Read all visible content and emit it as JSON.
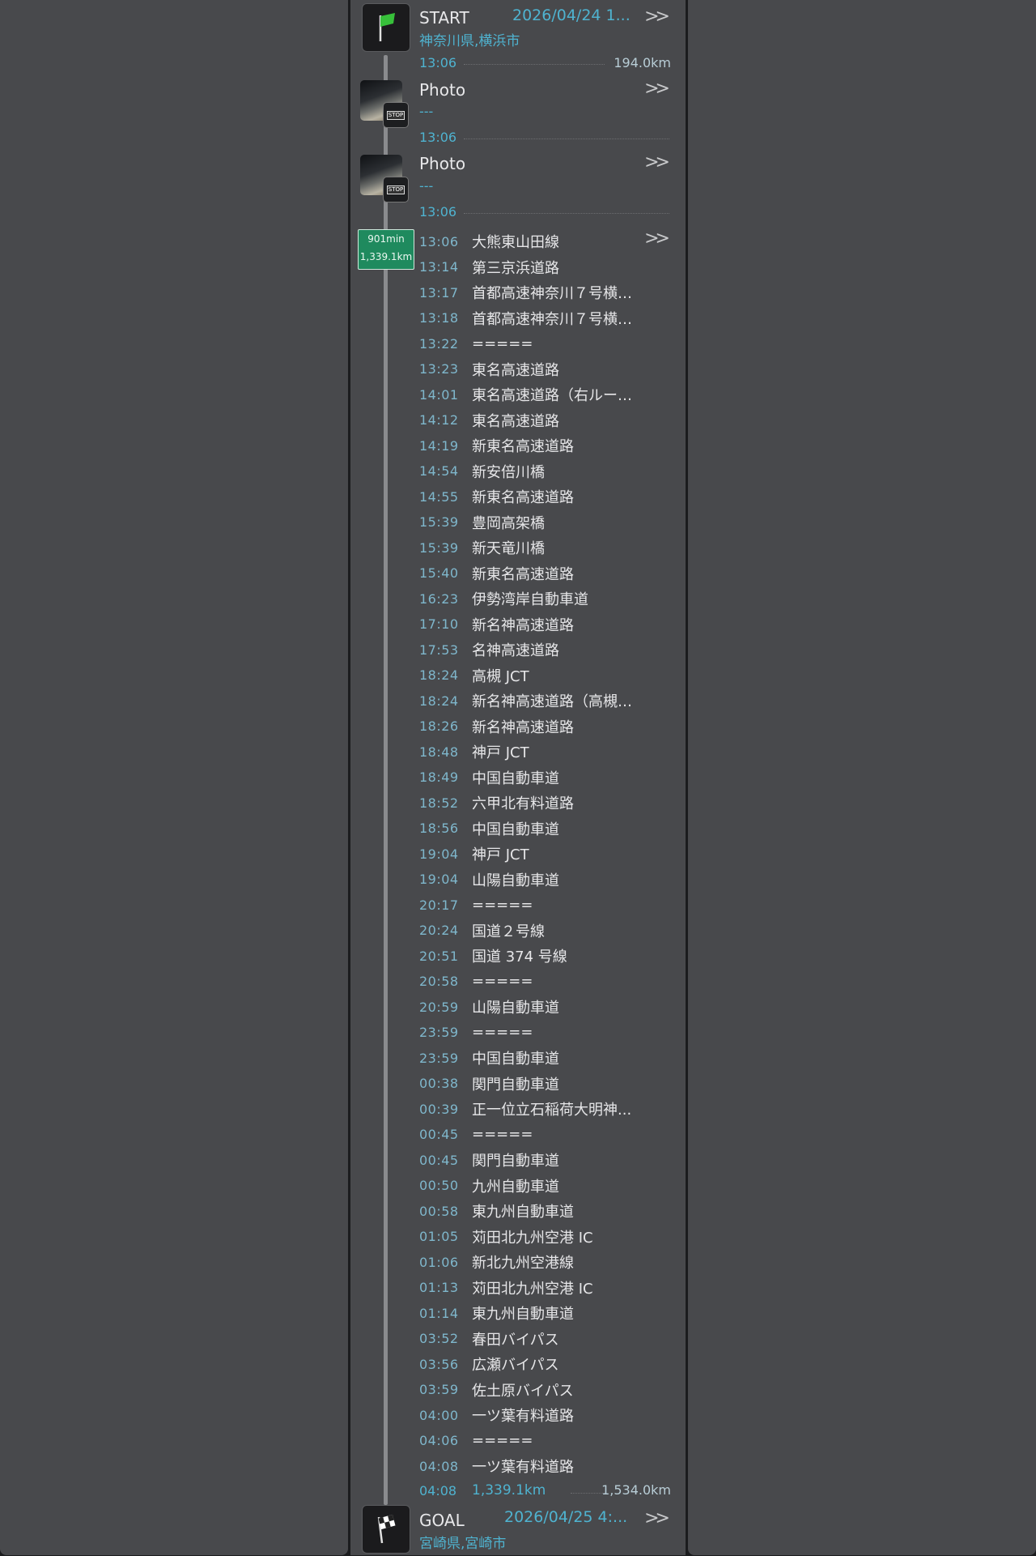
{
  "start": {
    "label": "START",
    "datetime": "2026/04/24 1...",
    "place": "神奈川県,横浜市",
    "time": "13:06",
    "distance": "194.0km"
  },
  "photos": [
    {
      "label": "Photo",
      "sub": "---",
      "time": "13:06",
      "stop": "STOP"
    },
    {
      "label": "Photo",
      "sub": "---",
      "time": "13:06",
      "stop": "STOP"
    }
  ],
  "segment": {
    "duration": "901min",
    "distance": "1,339.1km"
  },
  "route": [
    {
      "time": "13:06",
      "name": "大熊東山田線"
    },
    {
      "time": "13:14",
      "name": "第三京浜道路"
    },
    {
      "time": "13:17",
      "name": "首都高速神奈川７号横…"
    },
    {
      "time": "13:18",
      "name": "首都高速神奈川７号横…"
    },
    {
      "time": "13:22",
      "name": "====="
    },
    {
      "time": "13:23",
      "name": "東名高速道路"
    },
    {
      "time": "14:01",
      "name": "東名高速道路（右ルー…"
    },
    {
      "time": "14:12",
      "name": "東名高速道路"
    },
    {
      "time": "14:19",
      "name": "新東名高速道路"
    },
    {
      "time": "14:54",
      "name": "新安倍川橋"
    },
    {
      "time": "14:55",
      "name": "新東名高速道路"
    },
    {
      "time": "15:39",
      "name": "豊岡高架橋"
    },
    {
      "time": "15:39",
      "name": "新天竜川橋"
    },
    {
      "time": "15:40",
      "name": "新東名高速道路"
    },
    {
      "time": "16:23",
      "name": "伊勢湾岸自動車道"
    },
    {
      "time": "17:10",
      "name": "新名神高速道路"
    },
    {
      "time": "17:53",
      "name": "名神高速道路"
    },
    {
      "time": "18:24",
      "name": "高槻 JCT"
    },
    {
      "time": "18:24",
      "name": "新名神高速道路（高槻…"
    },
    {
      "time": "18:26",
      "name": "新名神高速道路"
    },
    {
      "time": "18:48",
      "name": "神戸 JCT"
    },
    {
      "time": "18:49",
      "name": "中国自動車道"
    },
    {
      "time": "18:52",
      "name": "六甲北有料道路"
    },
    {
      "time": "18:56",
      "name": "中国自動車道"
    },
    {
      "time": "19:04",
      "name": "神戸 JCT"
    },
    {
      "time": "19:04",
      "name": "山陽自動車道"
    },
    {
      "time": "20:17",
      "name": "====="
    },
    {
      "time": "20:24",
      "name": "国道２号線"
    },
    {
      "time": "20:51",
      "name": "国道 374 号線"
    },
    {
      "time": "20:58",
      "name": "====="
    },
    {
      "time": "20:59",
      "name": "山陽自動車道"
    },
    {
      "time": "23:59",
      "name": "====="
    },
    {
      "time": "23:59",
      "name": "中国自動車道"
    },
    {
      "time": "00:38",
      "name": "関門自動車道"
    },
    {
      "time": "00:39",
      "name": "正一位立石稲荷大明神..."
    },
    {
      "time": "00:45",
      "name": "====="
    },
    {
      "time": "00:45",
      "name": "関門自動車道"
    },
    {
      "time": "00:50",
      "name": "九州自動車道"
    },
    {
      "time": "00:58",
      "name": "東九州自動車道"
    },
    {
      "time": "01:05",
      "name": "苅田北九州空港 IC"
    },
    {
      "time": "01:06",
      "name": "新北九州空港線"
    },
    {
      "time": "01:13",
      "name": "苅田北九州空港 IC"
    },
    {
      "time": "01:14",
      "name": "東九州自動車道"
    },
    {
      "time": "03:52",
      "name": "春田バイパス"
    },
    {
      "time": "03:56",
      "name": "広瀬バイパス"
    },
    {
      "time": "03:59",
      "name": "佐土原バイパス"
    },
    {
      "time": "04:00",
      "name": "一ツ葉有料道路"
    },
    {
      "time": "04:06",
      "name": "====="
    },
    {
      "time": "04:08",
      "name": "一ツ葉有料道路"
    }
  ],
  "goal_summary": {
    "time": "04:08",
    "segment_distance": "1,339.1km",
    "total_distance": "1,534.0km"
  },
  "goal": {
    "label": "GOAL",
    "datetime": "2026/04/25 4:...",
    "place": "宮崎県,宮崎市"
  },
  "colors": {
    "accent": "#4fb3d0",
    "badge": "#1f8a5e",
    "panel": "#48494c"
  },
  "icons": {
    "start": "green-flag-icon",
    "goal": "checkered-flag-icon",
    "more": "double-chevron-right-icon"
  }
}
